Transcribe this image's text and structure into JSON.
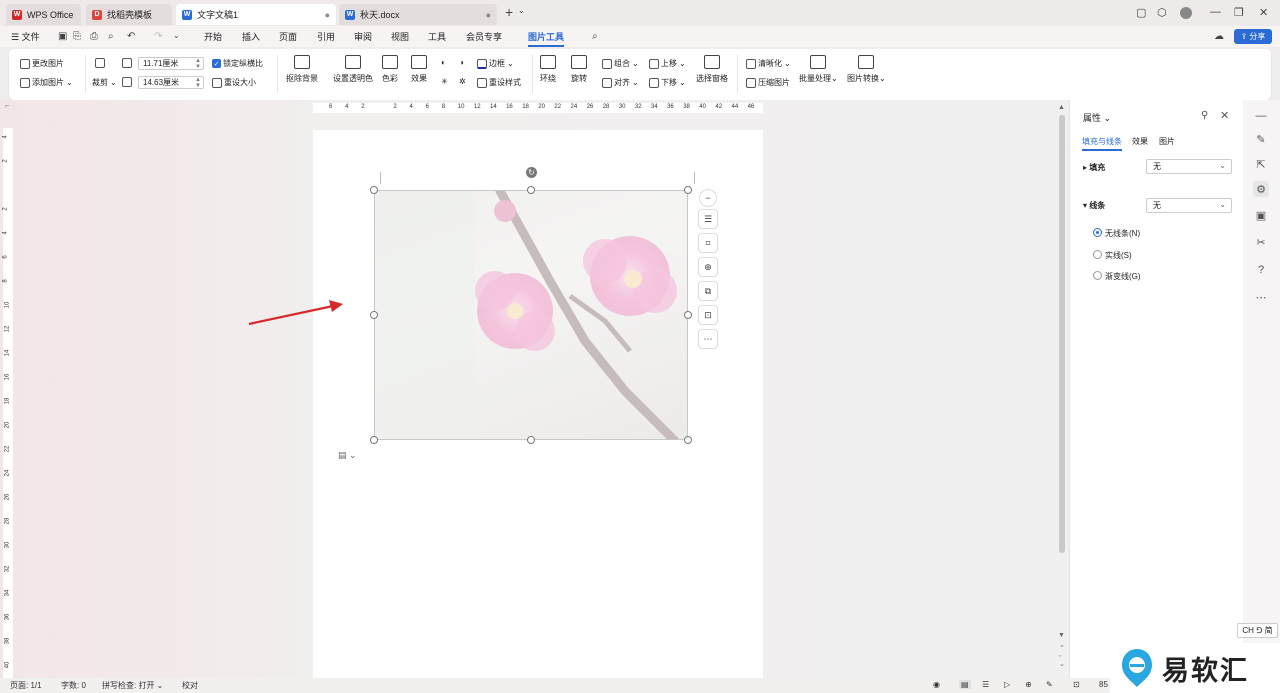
{
  "tabs": [
    {
      "label": "WPS Office",
      "icon": "wps-logo-icon",
      "color": "#d12b2b"
    },
    {
      "label": "找稻壳模板",
      "icon": "docer-icon",
      "color": "#e0443a"
    },
    {
      "label": "文字文稿1",
      "icon": "word-doc-icon",
      "color": "#2a6bd6"
    },
    {
      "label": "秋天.docx",
      "icon": "word-doc-icon",
      "color": "#2a6bd6"
    }
  ],
  "menu": {
    "file": "文件",
    "items": [
      "开始",
      "插入",
      "页面",
      "引用",
      "审阅",
      "视图",
      "工具",
      "会员专享",
      "图片工具"
    ],
    "share": "分享"
  },
  "ribbon": {
    "change_pic": "更改图片",
    "add_pic": "添加图片",
    "crop": "裁剪",
    "width": "11.71厘米",
    "height": "14.63厘米",
    "lock_ratio": "锁定纵横比",
    "reset_size": "重设大小",
    "remove_bg": "抠除背景",
    "set_transparent": "设置透明色",
    "color": "色彩",
    "effect": "效果",
    "border": "边框",
    "reset_style": "重设样式",
    "wrap": "环绕",
    "rotate": "旋转",
    "group": "组合",
    "align": "对齐",
    "bring_up": "上移",
    "send_down": "下移",
    "select_pane": "选择窗格",
    "sharpen": "清晰化",
    "compress": "压缩图片",
    "batch": "批量处理",
    "convert": "图片转换"
  },
  "ruler_h": [
    "6",
    "4",
    "2",
    "",
    "2",
    "4",
    "6",
    "8",
    "10",
    "12",
    "14",
    "16",
    "18",
    "20",
    "22",
    "24",
    "26",
    "28",
    "30",
    "32",
    "34",
    "36",
    "38",
    "40",
    "42",
    "44",
    "46"
  ],
  "ruler_v": [
    "4",
    "2",
    "",
    "2",
    "4",
    "6",
    "8",
    "10",
    "12",
    "14",
    "16",
    "18",
    "20",
    "22",
    "24",
    "26",
    "28",
    "30",
    "32",
    "34",
    "36",
    "38",
    "40"
  ],
  "panel": {
    "title": "属性",
    "tabs": [
      "填充与线条",
      "效果",
      "图片"
    ],
    "fill_label": "填充",
    "fill_value": "无",
    "line_label": "线条",
    "line_value": "无",
    "line_options": [
      "无线条(N)",
      "实线(S)",
      "渐变线(G)"
    ]
  },
  "status": {
    "page": "页面: 1/1",
    "words": "字数: 0",
    "spell": "拼写检查: 打开",
    "proof": "校对",
    "zoom": "85"
  },
  "ime": "CH ⅁ 简",
  "watermark": "易软汇"
}
